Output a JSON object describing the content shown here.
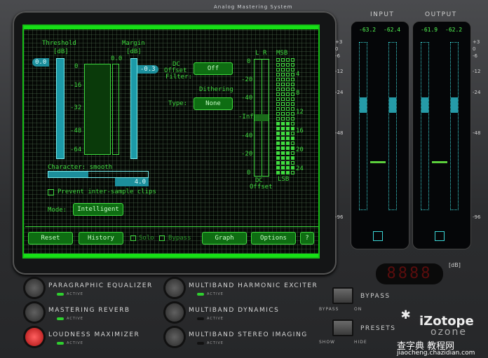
{
  "app": {
    "title": "Analog Mastering System",
    "brand": "iZotope",
    "product": "ozone"
  },
  "maximizer": {
    "threshold": {
      "label": "Threshold",
      "unit": "[dB]",
      "value": "0.0"
    },
    "margin": {
      "label": "Margin",
      "unit": "[dB]",
      "value": "-0.3"
    },
    "gr_value": "0.0",
    "gr_scale": [
      "0",
      "-16",
      "-32",
      "-48",
      "-64"
    ],
    "character": {
      "label": "Character: smooth",
      "value": "4.0",
      "fraction": 0.4
    },
    "prevent_clips_label": "Prevent inter-sample clips",
    "mode": {
      "label": "Mode:",
      "value": "Intelligent"
    }
  },
  "dc_offset": {
    "label_lines": [
      "DC",
      "Offset",
      "Filter:"
    ],
    "value": "Off",
    "meter_scale": [
      "0",
      "-20",
      "-40",
      "-Inf",
      "-40",
      "-20",
      "0"
    ],
    "channels": [
      "L",
      "R"
    ],
    "footer": [
      "DC",
      "Offset"
    ]
  },
  "dithering": {
    "heading": "Dithering",
    "type_label": "Type:",
    "value": "None"
  },
  "bits": {
    "top": "MSB",
    "bottom": "LSB",
    "labels": [
      "4",
      "8",
      "12",
      "16",
      "20",
      "24"
    ]
  },
  "toolbar": {
    "reset": "Reset",
    "history": "History",
    "solo": "Solo",
    "bypass": "Bypass",
    "graph": "Graph",
    "options": "Options",
    "help": "?"
  },
  "meters": {
    "input": {
      "label": "INPUT",
      "left": "-63.2",
      "right": "-62.4"
    },
    "output": {
      "label": "OUTPUT",
      "left": "-61.9",
      "right": "-62.2"
    },
    "scale": [
      "+3",
      "0",
      "-6",
      "-12",
      "-24",
      "-48",
      "-96"
    ],
    "unit": "[dB]",
    "readout": "8888"
  },
  "modules": [
    {
      "name": "PARAGRAPHIC EQUALIZER",
      "active": true,
      "selected": false
    },
    {
      "name": "MASTERING REVERB",
      "active": true,
      "selected": false
    },
    {
      "name": "LOUDNESS MAXIMIZER",
      "active": true,
      "selected": true
    },
    {
      "name": "MULTIBAND HARMONIC EXCITER",
      "active": true,
      "selected": false
    },
    {
      "name": "MULTIBAND DYNAMICS",
      "active": false,
      "selected": false
    },
    {
      "name": "MULTIBAND STEREO IMAGING",
      "active": false,
      "selected": false
    }
  ],
  "active_label": "ACTIVE",
  "bypass": {
    "label": "BYPASS",
    "left": "BYPASS",
    "right": "ON"
  },
  "presets": {
    "label": "PRESETS",
    "left": "SHOW",
    "right": "HIDE"
  },
  "watermark": {
    "line1": "查字典 教程网",
    "line2": "jiaocheng.chazidian.com"
  }
}
